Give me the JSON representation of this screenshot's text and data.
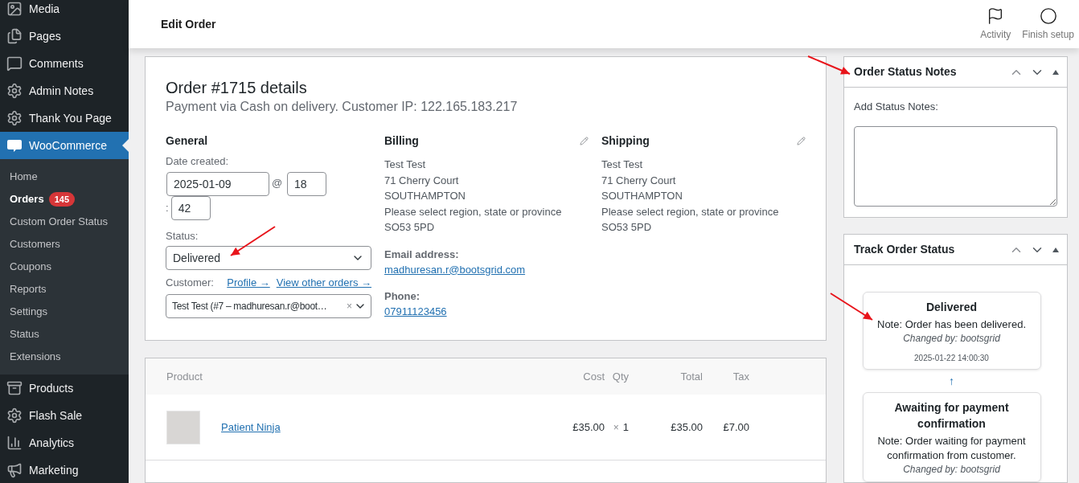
{
  "sidebar": {
    "items": [
      {
        "label": "Media",
        "selected": false
      },
      {
        "label": "Pages",
        "selected": false
      },
      {
        "label": "Comments",
        "selected": false
      },
      {
        "label": "Admin Notes",
        "selected": false
      },
      {
        "label": "Thank You Page",
        "selected": false
      },
      {
        "label": "WooCommerce",
        "selected": true,
        "children": [
          {
            "label": "Home",
            "selected": false
          },
          {
            "label": "Orders",
            "selected": true,
            "badge": "145"
          },
          {
            "label": "Custom Order Status",
            "selected": false
          },
          {
            "label": "Customers",
            "selected": false
          },
          {
            "label": "Coupons",
            "selected": false
          },
          {
            "label": "Reports",
            "selected": false
          },
          {
            "label": "Settings",
            "selected": false
          },
          {
            "label": "Status",
            "selected": false
          },
          {
            "label": "Extensions",
            "selected": false
          }
        ]
      },
      {
        "label": "Products",
        "selected": false
      },
      {
        "label": "Flash Sale",
        "selected": false
      },
      {
        "label": "Analytics",
        "selected": false
      },
      {
        "label": "Marketing",
        "selected": false
      }
    ]
  },
  "header": {
    "title": "Edit Order",
    "actions": [
      {
        "label": "Activity"
      },
      {
        "label": "Finish setup"
      }
    ]
  },
  "order": {
    "title": "Order #1715 details",
    "subtitle": "Payment via Cash on delivery. Customer IP: 122.165.183.217",
    "general": {
      "heading": "General",
      "date_label": "Date created:",
      "date": "2025-01-09",
      "at": "@",
      "hour": "18",
      "colon": ":",
      "minute": "42",
      "status_label": "Status:",
      "status": "Delivered",
      "customer_label": "Customer:",
      "links": [
        "Profile →",
        "View other orders →"
      ],
      "customer": "Test Test (#7 – madhuresan.r@boot…",
      "clear": "×"
    },
    "billing": {
      "heading": "Billing",
      "lines": [
        "Test Test",
        "71 Cherry Court",
        "SOUTHAMPTON",
        "Please select region, state or province",
        "SO53 5PD"
      ],
      "email_label": "Email address:",
      "email": "madhuresan.r@bootsgrid.com",
      "phone_label": "Phone:",
      "phone": "07911123456"
    },
    "shipping": {
      "heading": "Shipping",
      "lines": [
        "Test Test",
        "71 Cherry Court",
        "SOUTHAMPTON",
        "Please select region, state or province",
        "SO53 5PD"
      ]
    }
  },
  "items_table": {
    "columns": [
      "Product",
      "Cost",
      "Qty",
      "Total",
      "Tax"
    ],
    "rows": [
      {
        "product": "Patient Ninja",
        "cost": "£35.00",
        "qty_sign": "×",
        "qty": "1",
        "total": "£35.00",
        "tax": "£7.00"
      }
    ]
  },
  "status_notes": {
    "title": "Order Status Notes",
    "label": "Add Status Notes:"
  },
  "track": {
    "title": "Track Order Status",
    "connector": "↑",
    "entries": [
      {
        "status": "Delivered",
        "note": "Note: Order has been delivered.",
        "changed_by": "Changed by: bootsgrid",
        "date": "2025-01-22 14:00:30"
      },
      {
        "status": "Awaiting for payment confirmation",
        "note": "Note: Order waiting for payment confirmation from customer.",
        "changed_by": "Changed by: bootsgrid"
      }
    ]
  }
}
